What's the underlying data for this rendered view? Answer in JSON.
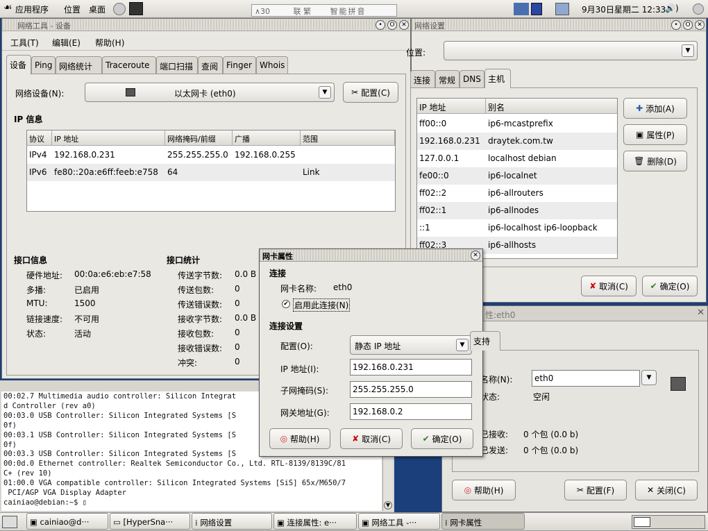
{
  "top_panel": {
    "menu_apps": "应用程序",
    "menu_places": "位置",
    "menu_desktop": "桌面",
    "ime": {
      "items": [
        "联",
        "繁",
        "智能拼音"
      ],
      "mode": "∧30"
    },
    "datetime": "9月30日星期二 12:33"
  },
  "net_tool": {
    "title": "网络工具 - 设备",
    "menu": [
      "工具(T)",
      "编辑(E)",
      "帮助(H)"
    ],
    "tabs": [
      "设备",
      "Ping",
      "网络统计",
      "Traceroute",
      "端口扫描",
      "查阅",
      "Finger",
      "Whois"
    ],
    "device_label": "网络设备(N):",
    "device_value": "以太网卡 (eth0)",
    "config_button": "配置(C)",
    "ip_info_title": "IP 信息",
    "ip_columns": [
      "协议",
      "IP 地址",
      "网络掩码/前缀",
      "广播",
      "范围"
    ],
    "ip_rows": [
      [
        "IPv4",
        "192.168.0.231",
        "255.255.255.0",
        "192.168.0.255",
        ""
      ],
      [
        "IPv6",
        "fe80::20a:e6ff:feeb:e758",
        "64",
        "",
        "Link"
      ]
    ],
    "iface_title": "接口信息",
    "iface": [
      [
        "硬件地址:",
        "00:0a:e6:eb:e7:58"
      ],
      [
        "多播:",
        "已启用"
      ],
      [
        "MTU:",
        "1500"
      ],
      [
        "链接速度:",
        "不可用"
      ],
      [
        "状态:",
        "活动"
      ]
    ],
    "stats_title": "接口统计",
    "stats": [
      [
        "传送字节数:",
        "0.0 B"
      ],
      [
        "传送包数:",
        "0"
      ],
      [
        "传送错误数:",
        "0"
      ],
      [
        "接收字节数:",
        "0.0 B"
      ],
      [
        "接收包数:",
        "0"
      ],
      [
        "接收错误数:",
        "0"
      ],
      [
        "冲突:",
        "0"
      ]
    ]
  },
  "terminal": {
    "lines": [
      "00:02.7 Multimedia audio controller: Silicon Integrat",
      "d Controller (rev a0)",
      "00:03.0 USB Controller: Silicon Integrated Systems [S",
      "0f)",
      "00:03.1 USB Controller: Silicon Integrated Systems [S",
      "0f)",
      "00:03.3 USB Controller: Silicon Integrated Systems [S",
      "00:0d.0 Ethernet controller: Realtek Semiconductor Co., Ltd. RTL-8139/8139C/81",
      "C+ (rev 10)",
      "01:00.0 VGA compatible controller: Silicon Integrated Systems [SiS] 65x/M650/7",
      " PCI/AGP VGA Display Adapter",
      "cainiao@debian:~$ ▯"
    ]
  },
  "net_settings": {
    "title": "网络设置",
    "location_label": "位置:",
    "tabs": [
      "连接",
      "常规",
      "DNS",
      "主机"
    ],
    "columns": [
      "IP 地址",
      "别名"
    ],
    "hosts": [
      [
        "ff00::0",
        "ip6-mcastprefix"
      ],
      [
        "192.168.0.231",
        "draytek.com.tw"
      ],
      [
        "127.0.0.1",
        "localhost debian"
      ],
      [
        "fe00::0",
        "ip6-localnet"
      ],
      [
        "ff02::2",
        "ip6-allrouters"
      ],
      [
        "ff02::1",
        "ip6-allnodes"
      ],
      [
        "::1",
        "ip6-localhost ip6-loopback"
      ],
      [
        "ff02::3",
        "ip6-allhosts"
      ]
    ],
    "add": "添加(A)",
    "properties": "属性(P)",
    "delete": "删除(D)",
    "cancel": "取消(C)",
    "ok": "确定(O)"
  },
  "conn_props": {
    "title": "性:eth0",
    "tab": "支持",
    "name_label": "名称(N):",
    "name_value": "eth0",
    "status_label": "状态:",
    "status_value": "空闲",
    "recv_label": "已接收:",
    "recv_value": "0 个包 (0.0 b)",
    "sent_label": "已发送:",
    "sent_value": "0 个包 (0.0 b)",
    "help": "帮助(H)",
    "config": "配置(F)",
    "close": "关闭(C)"
  },
  "nic_dialog": {
    "title": "网卡属性",
    "conn_title": "连接",
    "name_label": "网卡名称:",
    "name_value": "eth0",
    "enable_label": "启用此连接(N)",
    "settings_title": "连接设置",
    "config_label": "配置(O):",
    "config_value": "静态 IP 地址",
    "ip_label": "IP 地址(I):",
    "ip_value": "192.168.0.231",
    "mask_label": "子网掩码(S):",
    "mask_value": "255.255.255.0",
    "gw_label": "网关地址(G):",
    "gw_value": "192.168.0.2",
    "help": "帮助(H)",
    "cancel": "取消(C)",
    "ok": "确定(O)"
  },
  "taskbar": [
    "cainiao@d···",
    "[HyperSna···",
    "网络设置",
    "连接属性: e···",
    "网络工具 -···",
    "网卡属性"
  ]
}
